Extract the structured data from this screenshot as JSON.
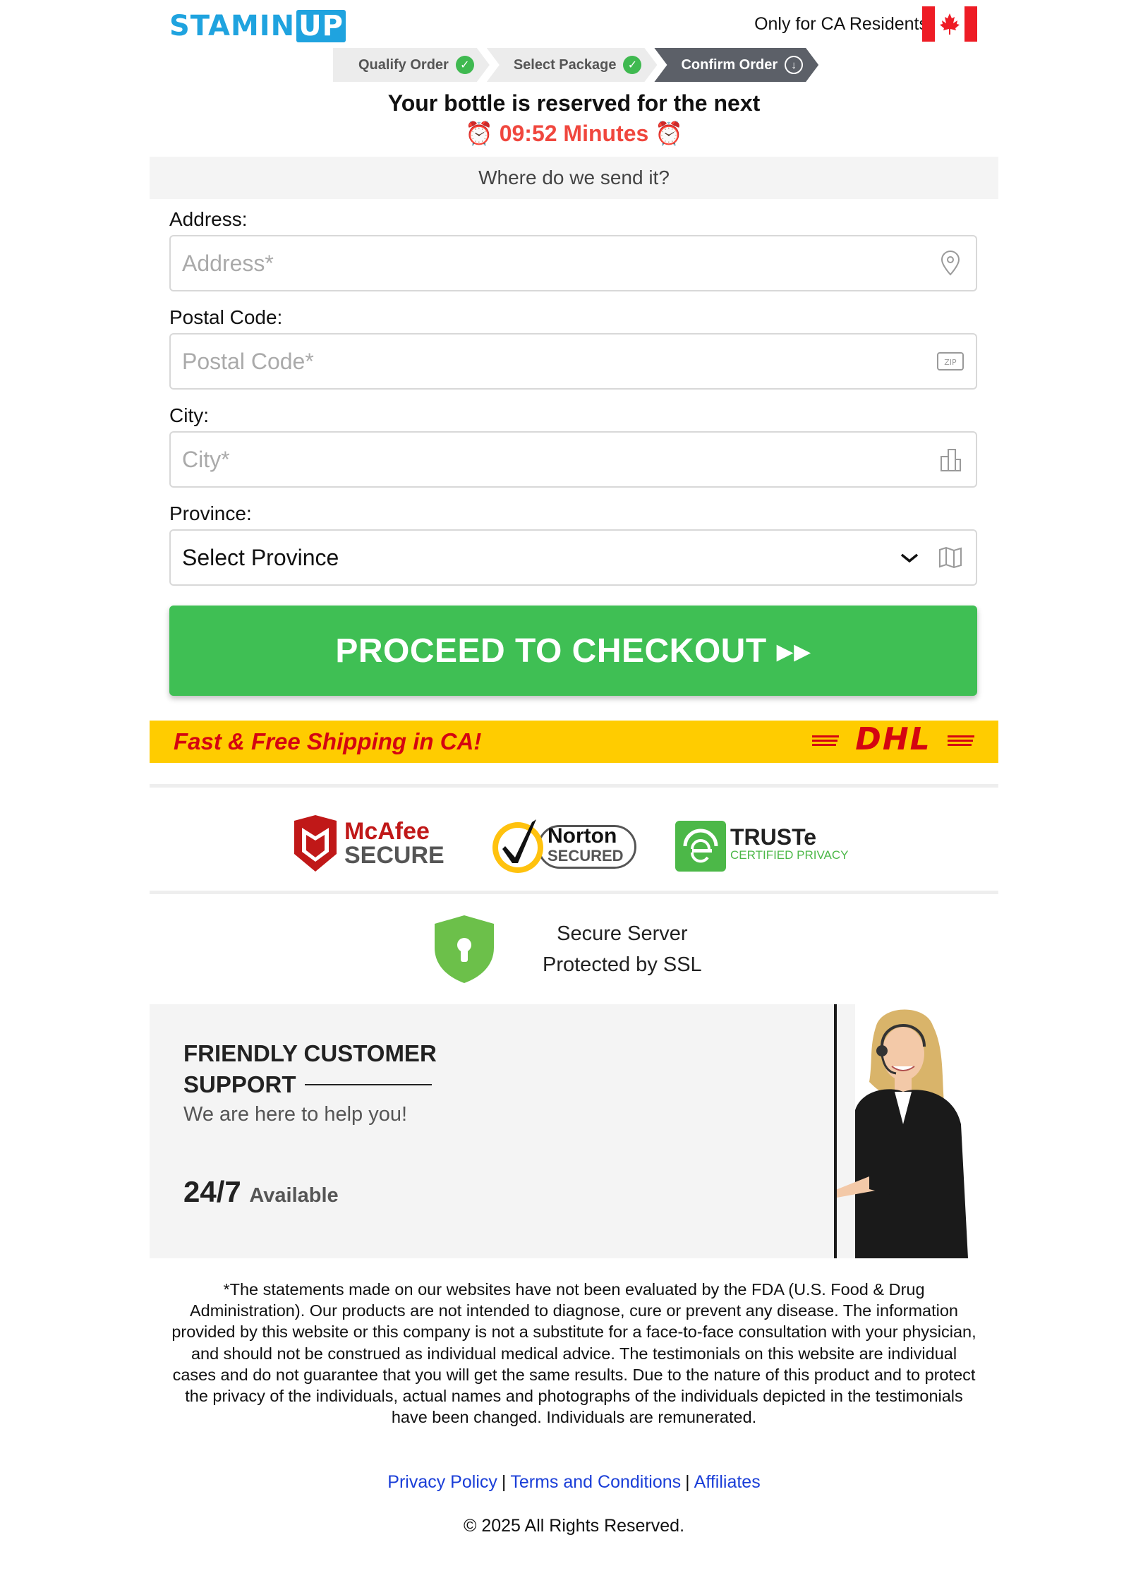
{
  "header": {
    "logo_main": "STAMIN",
    "logo_suffix": "UP",
    "residents": "Only for CA Residents"
  },
  "steps": [
    {
      "label": "Qualify Order",
      "state": "done"
    },
    {
      "label": "Select Package",
      "state": "done"
    },
    {
      "label": "Confirm Order",
      "state": "active"
    }
  ],
  "reserve": {
    "headline": "Your bottle is reserved for the next",
    "timer": "⏰ 09:52 Minutes ⏰"
  },
  "form": {
    "heading": "Where do we send it?",
    "address": {
      "label": "Address:",
      "placeholder": "Address*"
    },
    "postal": {
      "label": "Postal Code:",
      "placeholder": "Postal Code*"
    },
    "city": {
      "label": "City:",
      "placeholder": "City*"
    },
    "province": {
      "label": "Province:",
      "selected": "Select Province"
    },
    "submit": "PROCEED TO CHECKOUT ▸▸"
  },
  "shipping": {
    "text": "Fast & Free Shipping in CA!",
    "carrier": "DHL"
  },
  "badges": {
    "mcafee_top": "McAfee",
    "mcafee_bottom": "SECURE",
    "norton_top": "Norton",
    "norton_bottom": "SECURED",
    "truste_top": "TRUSTe",
    "truste_bottom": "CERTIFIED PRIVACY"
  },
  "ssl": {
    "line1": "Secure Server",
    "line2": "Protected by SSL"
  },
  "support": {
    "title_line1": "FRIENDLY CUSTOMER",
    "title_line2": "SUPPORT",
    "subtitle": "We are here to help you!",
    "hours": "24/7",
    "hours_suffix": "Available"
  },
  "disclaimer": "*The statements made on our websites have not been evaluated by the FDA (U.S. Food & Drug Administration). Our products are not intended to diagnose, cure or prevent any disease. The information provided by this website or this company is not a substitute for a face-to-face consultation with your physician, and should not be construed as individual medical advice. The testimonials on this website are individual cases and do not guarantee that you will get the same results. Due to the nature of this product and to protect the privacy of the individuals, actual names and photographs of the individuals depicted in the testimonials have been changed. Individuals are remunerated.",
  "footer": {
    "privacy": "Privacy Policy",
    "terms": "Terms and Conditions",
    "affiliates": "Affiliates",
    "copyright": "© 2025 All Rights Reserved."
  },
  "colors": {
    "brand": "#1fa3df",
    "timer": "#f0473e",
    "cta": "#3fbf54",
    "shipping_bar": "#ffcc00",
    "dhl_red": "#d40511"
  }
}
